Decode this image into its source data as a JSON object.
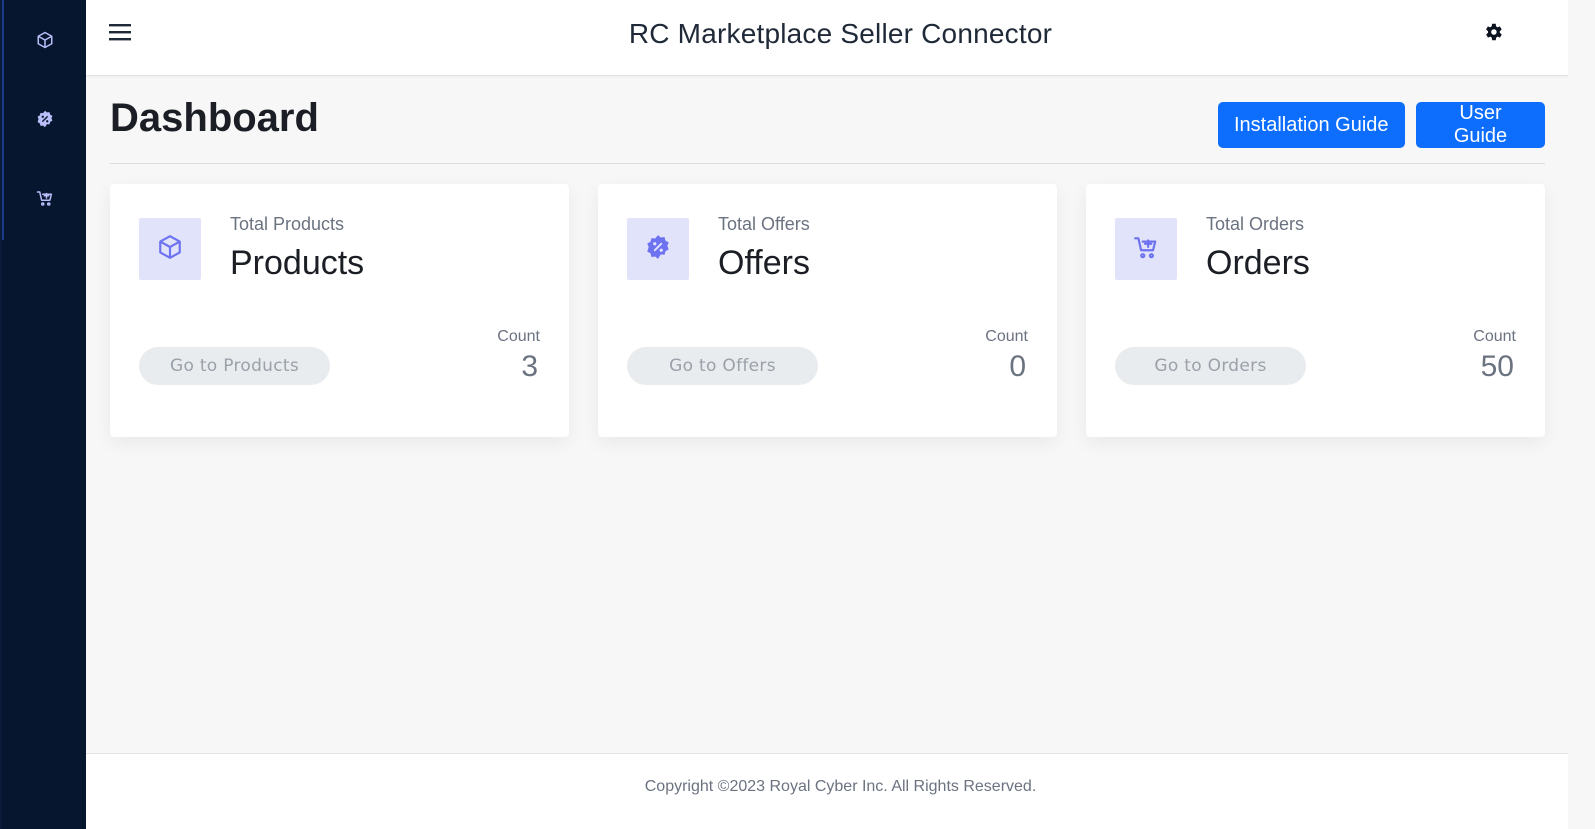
{
  "header": {
    "title": "RC Marketplace Seller Connector"
  },
  "sidebar": {
    "items": [
      {
        "icon": "box-icon"
      },
      {
        "icon": "discount-badge-icon"
      },
      {
        "icon": "cart-plus-icon"
      }
    ]
  },
  "page": {
    "title": "Dashboard",
    "installation_guide_label": "Installation Guide",
    "user_guide_label": "User Guide"
  },
  "cards": [
    {
      "subtitle": "Total Products",
      "title": "Products",
      "button_label": "Go to Products",
      "count_label": "Count",
      "count": "3",
      "icon": "box-icon"
    },
    {
      "subtitle": "Total Offers",
      "title": "Offers",
      "button_label": "Go to Offers",
      "count_label": "Count",
      "count": "0",
      "icon": "discount-badge-icon"
    },
    {
      "subtitle": "Total Orders",
      "title": "Orders",
      "button_label": "Go to Orders",
      "count_label": "Count",
      "count": "50",
      "icon": "cart-plus-icon"
    }
  ],
  "footer": {
    "copyright": "Copyright ©2023 Royal Cyber Inc. All Rights Reserved."
  },
  "colors": {
    "sidebar_bg": "#06162f",
    "primary": "#0d6efd",
    "icon_accent": "#6d72f0",
    "icon_bg": "#e1e3fb"
  }
}
